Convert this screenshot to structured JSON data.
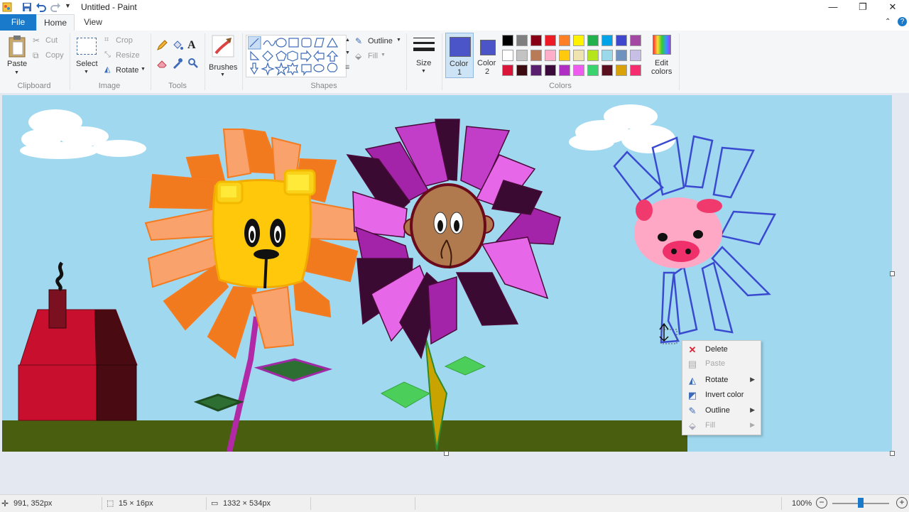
{
  "window": {
    "title": "Untitled - Paint",
    "minimize": "—",
    "maximize": "❐",
    "close": "✕"
  },
  "tabs": {
    "file": "File",
    "home": "Home",
    "view": "View"
  },
  "ribbon": {
    "clipboard": {
      "paste": "Paste",
      "cut": "Cut",
      "copy": "Copy",
      "label": "Clipboard"
    },
    "image": {
      "select": "Select",
      "crop": "Crop",
      "resize": "Resize",
      "rotate": "Rotate",
      "label": "Image"
    },
    "tools": {
      "label": "Tools"
    },
    "brushes": {
      "label": "Brushes"
    },
    "shapes": {
      "outline": "Outline",
      "fill": "Fill",
      "label": "Shapes"
    },
    "size": {
      "label": "Size"
    },
    "colors": {
      "color1": "Color",
      "color1_num": "1",
      "color2": "Color",
      "color2_num": "2",
      "edit": "Edit",
      "edit2": "colors",
      "label": "Colors",
      "color1_value": "#4b55c8",
      "color2_value": "#4b55c8",
      "palette": [
        [
          "#000000",
          "#7f7f7f",
          "#880015",
          "#ed1c24",
          "#ff7f27",
          "#fff200",
          "#22b14c",
          "#00a2e8",
          "#3f48cc",
          "#a349a4"
        ],
        [
          "#ffffff",
          "#c3c3c3",
          "#b97a57",
          "#ffaec9",
          "#ffc90e",
          "#efe4b0",
          "#b5e61d",
          "#99d9ea",
          "#7092be",
          "#c8bfe7"
        ],
        [
          "#d9153a",
          "#3d0c12",
          "#5a2070",
          "#3a0b3a",
          "#b02ec4",
          "#ef5bef",
          "#39d46e",
          "#5a0f1e",
          "#d9a20b",
          "#f52d6e"
        ]
      ]
    }
  },
  "context_menu": {
    "items": [
      {
        "label": "Delete",
        "icon": "delete-x-icon",
        "enabled": true,
        "submenu": false
      },
      {
        "label": "Paste",
        "icon": "paste-icon",
        "enabled": false,
        "submenu": false
      },
      {
        "label": "Rotate",
        "icon": "rotate-icon",
        "enabled": true,
        "submenu": true
      },
      {
        "label": "Invert color",
        "icon": "invert-color-icon",
        "enabled": true,
        "submenu": false
      },
      {
        "label": "Outline",
        "icon": "outline-icon",
        "enabled": true,
        "submenu": true
      },
      {
        "label": "Fill",
        "icon": "fill-icon",
        "enabled": false,
        "submenu": true
      }
    ]
  },
  "status": {
    "cursor_pos": "991, 352px",
    "selection_size": "15 × 16px",
    "image_size": "1332 × 534px",
    "zoom": "100%",
    "zoom_fraction": 0.5
  }
}
